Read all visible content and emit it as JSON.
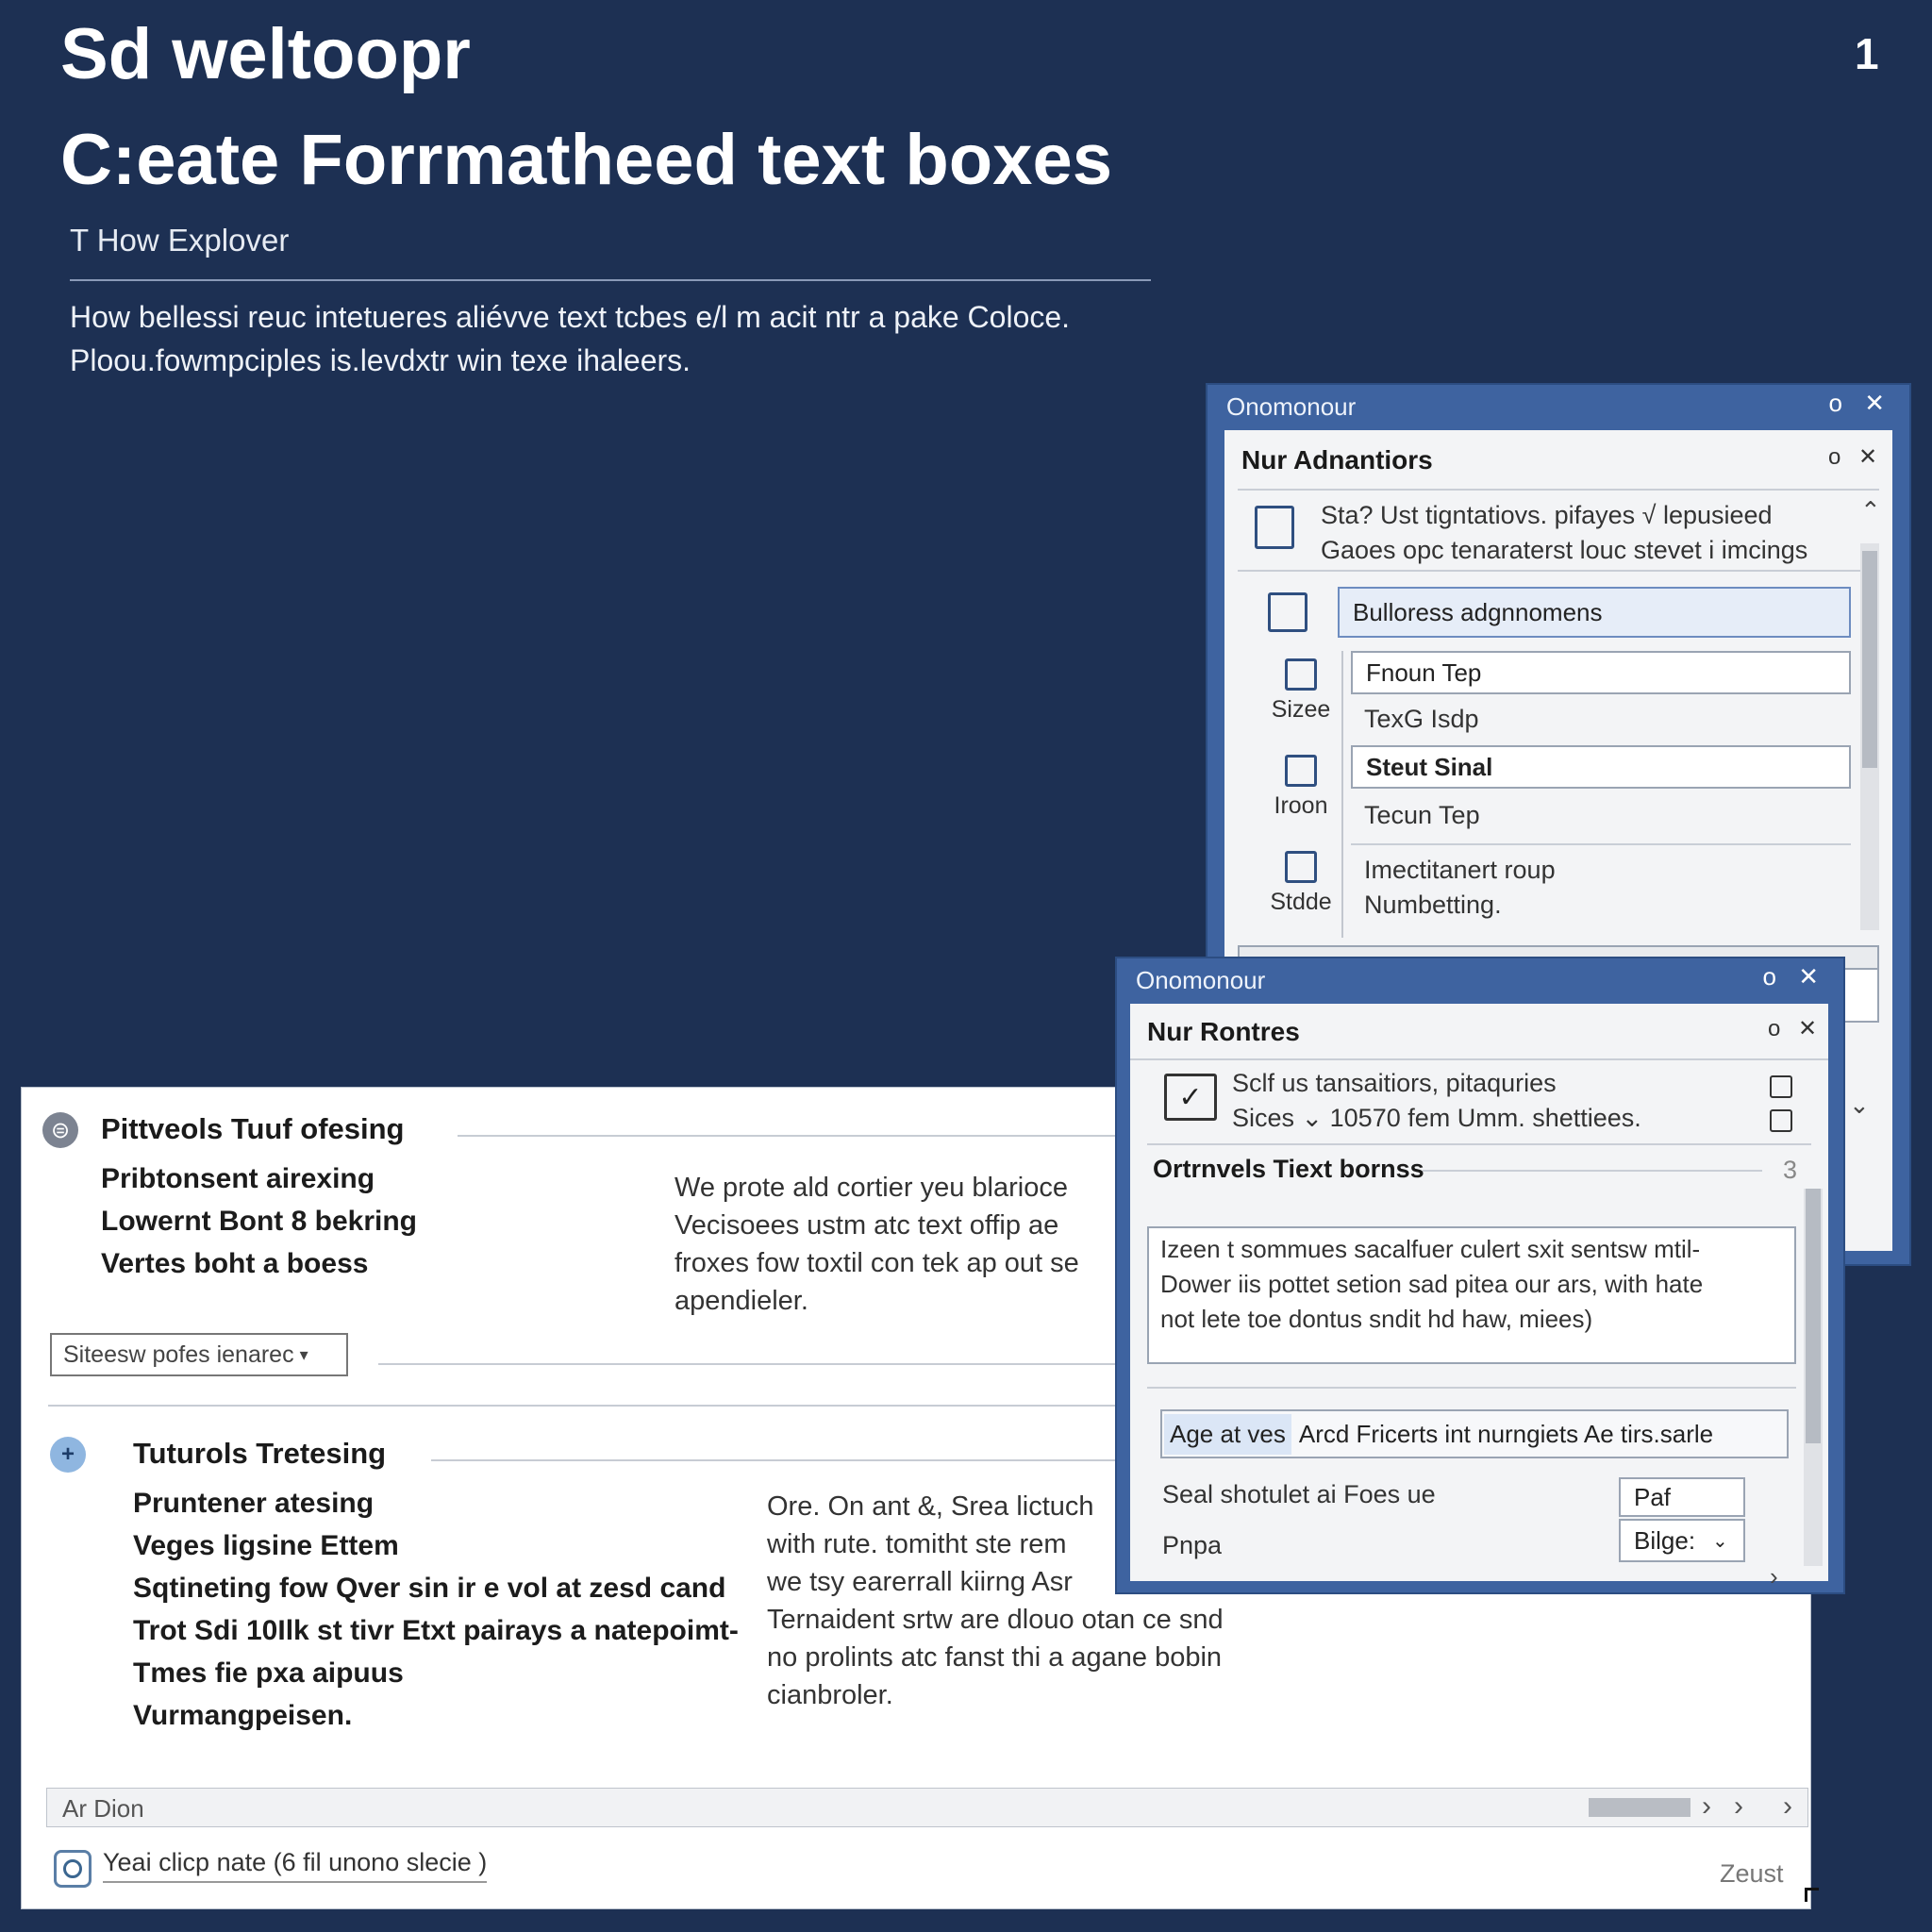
{
  "header": {
    "title_line1": "Sd weltoopr",
    "title_line2": "C:eate Forrmatheed text boxes",
    "subtitle": "T How Explover",
    "intro_line1": "How bellessi reuc intetueres aliévve text tcbes e/l m acit ntr a pake Coloce.",
    "intro_line2": "Ploou.fowmpciples is.levdxtr win texe ihaleers.",
    "corner_icon": "1"
  },
  "document": {
    "section1": {
      "title": "Pittveols Tuuf ofesing",
      "items": [
        "Pribtonsent airexing",
        "Lowernt Bont 8 bekring",
        "Vertes boht a boess"
      ],
      "paragraph": [
        "We prote ald cortier yeu blarioce",
        "Vecisoees ustm atc text offip ae",
        "froxes fow toxtil con tek ap out se",
        "apendieler."
      ]
    },
    "dropdown_label": "Siteesw pofes ienarec",
    "section2": {
      "title": "Tuturols Tretesing",
      "items": [
        "Pruntener atesing",
        "Veges ligsine Ettem",
        "Sqtineting fow Qver sin ir e vol at zesd cand",
        "Trot Sdi 10Ilk st tivr Etxt pairays a natepoimt-",
        "Tmes fie pxa aipuus",
        "Vurmangpeisen."
      ],
      "paragraph": [
        "Ore. On ant &, Srea lictuch",
        "with rute. tomitht ste rem",
        "we tsy earerrall kiirng Asr",
        "Ternaident srtw are dlouo otan ce snd",
        "no prolints atc fanst thi a agane bobin",
        "cianbroler."
      ]
    },
    "bar_label": "Ar Dion",
    "footer_text": "Yeai clicp nate (6 fil unono slecie )",
    "footer_right": "Zeust"
  },
  "dialog_back": {
    "title": "Onomonour",
    "panel_title": "Nur Adnantiors",
    "summary_line1": "Sta? Ust tigntatiovs. pifayes √ lepusieed",
    "summary_line2": "Gaoes opc tenaraterst louc stevet i imcings",
    "highlight_field": "Bulloress adgnnomens",
    "rows": [
      {
        "label": "Sizee",
        "field": "Fnoun Tep",
        "sub": "TexG Isdp"
      },
      {
        "label": "Iroon",
        "field": "Steut Sinal",
        "sub": "Tecun Tep"
      },
      {
        "label": "Stdde",
        "field": "Imectitanert roup",
        "sub": "Numbetting."
      }
    ],
    "window_buttons": "o ✕",
    "panel_buttons": "o ✕"
  },
  "dialog_front": {
    "title": "Onomonour",
    "panel_title": "Nur Rontres",
    "info_line1": "Sclf us tansaitiors, pitaquries",
    "info_line2": "Sices ⌄ 10570 fem Umm. shettiees.",
    "section_title": "Ortrnvels Tiext bornss",
    "section_num": "3",
    "textarea_lines": [
      "Izeen t sommues sacalfuer culert sxit sentsw mtil-",
      "Dower iis pottet setion sad pitea our ars, with hate",
      "not lete toe dontus sndit hd haw, miees)"
    ],
    "tab_active": "Age at ves",
    "tab_rest": "Arcd Fricerts int nurngiets Ae tirs.sarle",
    "row1_label": "Seal shotulet ai Foes ue",
    "row1_value": "Paf",
    "row2_label": "Pnpa",
    "row2_value": "Bilge:",
    "window_buttons": "o ✕",
    "panel_buttons": "o ✕"
  }
}
